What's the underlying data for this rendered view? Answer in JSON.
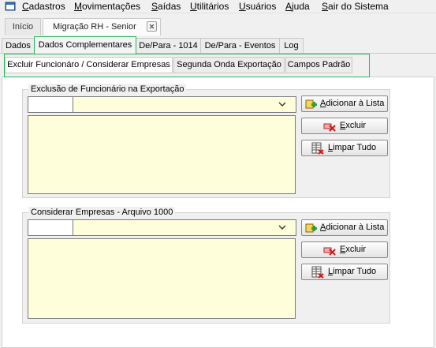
{
  "menu": [
    {
      "mnemonic": "C",
      "rest": "adastros"
    },
    {
      "mnemonic": "M",
      "rest": "ovimentações"
    },
    {
      "mnemonic": "S",
      "rest": "aídas"
    },
    {
      "mnemonic": "U",
      "rest": "tilitários"
    },
    {
      "mnemonic": "U",
      "rest": "suários"
    },
    {
      "mnemonic": "A",
      "rest": "juda"
    },
    {
      "mnemonic": "S",
      "rest": "air do Sistema"
    }
  ],
  "document_tabs": {
    "home": "Início",
    "active": "Migração RH - Senior",
    "close_symbol": "⊠"
  },
  "tabs_level1": [
    "Dados",
    "Dados Complementares",
    "De/Para - 1014",
    "De/Para - Eventos",
    "Log"
  ],
  "tabs_level1_active": "Dados Complementares",
  "tabs_level2": [
    "Excluir Funcionáro / Considerar Empresas",
    "Segunda Onda Exportação",
    "Campos Padrão"
  ],
  "tabs_level2_active": "Excluir Funcionáro / Considerar Empresas",
  "groups": [
    {
      "title": "Exclusão de Funcionário na Exportação",
      "code_value": "",
      "combo_value": "",
      "buttons": {
        "add": {
          "mnemonic": "A",
          "rest": "dicionar à Lista"
        },
        "delete": {
          "mnemonic": "E",
          "rest": "xcluir"
        },
        "clear": {
          "mnemonic": "L",
          "rest": "impar Tudo"
        }
      }
    },
    {
      "title": "Considerar Empresas - Arquivo 1000",
      "code_value": "",
      "combo_value": "",
      "buttons": {
        "add": {
          "mnemonic": "A",
          "rest": "dicionar à Lista"
        },
        "delete": {
          "mnemonic": "E",
          "rest": "xcluir"
        },
        "clear": {
          "mnemonic": "L",
          "rest": "impar Tudo"
        }
      }
    }
  ],
  "colors": {
    "highlight_green": "#27b85a",
    "field_yellow": "#fffedb",
    "window_bg": "#f0f0f0"
  }
}
